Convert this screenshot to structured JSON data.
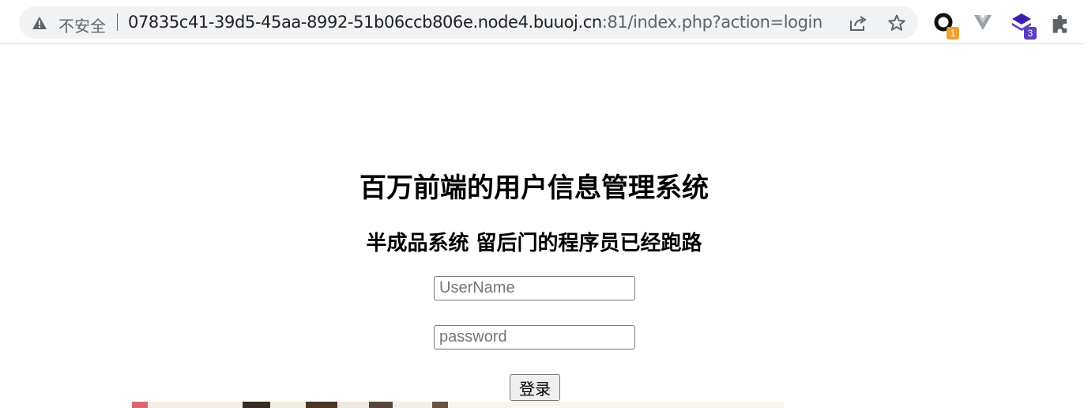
{
  "browser": {
    "security_label": "不安全",
    "url_host": "07835c41-39d5-45aa-8992-51b06ccb806e.node4.buuoj.cn",
    "url_rest": ":81/index.php?action=login",
    "icons": [
      "warning-icon",
      "share-icon",
      "star-icon",
      "extension-icon-1",
      "extension-icon-2",
      "extension-icon-3",
      "puzzle-icon"
    ],
    "extensions": [
      {
        "name": "extension-1",
        "badge": "1",
        "badge_color": "#f0a030"
      },
      {
        "name": "extension-2",
        "badge": "",
        "badge_color": ""
      },
      {
        "name": "extension-3",
        "badge": "3",
        "badge_color": "#5b3cc4"
      }
    ]
  },
  "page": {
    "title": "百万前端的用户信息管理系统",
    "subtitle": "半成品系统 留后门的程序员已经跑路",
    "username_placeholder": "UserName",
    "password_placeholder": "password",
    "login_label": "登录"
  }
}
